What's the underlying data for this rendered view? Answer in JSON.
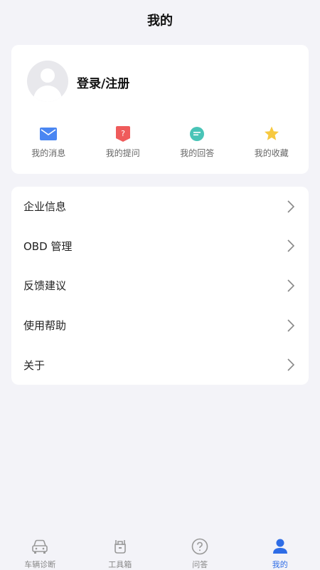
{
  "header": {
    "title": "我的"
  },
  "profile": {
    "login_label": "登录/注册"
  },
  "quick_actions": [
    {
      "label": "我的消息",
      "icon": "envelope-icon",
      "color": "#4a86f2"
    },
    {
      "label": "我的提问",
      "icon": "question-tag-icon",
      "color": "#ef5b5b"
    },
    {
      "label": "我的回答",
      "icon": "chat-bubble-icon",
      "color": "#49c4b7"
    },
    {
      "label": "我的收藏",
      "icon": "star-icon",
      "color": "#f7c940"
    }
  ],
  "menu": [
    {
      "label": "企业信息"
    },
    {
      "label": "OBD 管理"
    },
    {
      "label": "反馈建议"
    },
    {
      "label": "使用帮助"
    },
    {
      "label": "关于"
    }
  ],
  "tabbar": [
    {
      "label": "车辆诊断",
      "icon": "car-icon",
      "active": false
    },
    {
      "label": "工具箱",
      "icon": "toolbox-icon",
      "active": false
    },
    {
      "label": "问答",
      "icon": "question-circle-icon",
      "active": false
    },
    {
      "label": "我的",
      "icon": "user-icon",
      "active": true
    }
  ],
  "colors": {
    "accent": "#2e6ce6",
    "inactive": "#888888",
    "background": "#f3f3f8"
  }
}
